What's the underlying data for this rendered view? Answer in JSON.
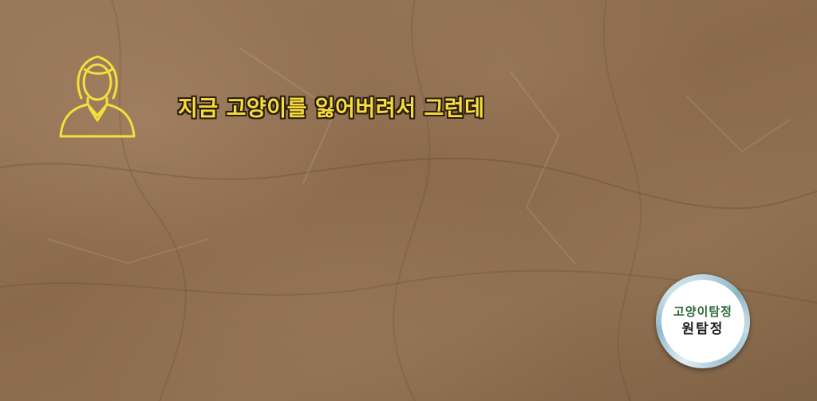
{
  "scene": {
    "dialogue_text": "지금 고양이를 잃어버려서 그런데",
    "dialogue_color": "#f7dc3a",
    "speaker_icon": "woman-avatar-icon"
  },
  "badge": {
    "title": "고양이탐정",
    "name": "원탐정",
    "title_color": "#2f6b3c"
  }
}
